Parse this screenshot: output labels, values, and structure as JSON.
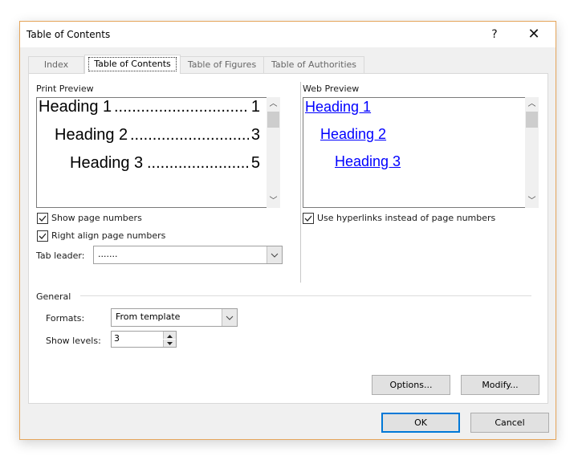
{
  "window": {
    "title": "Table of Contents",
    "help_label": "?",
    "close_label": "✕"
  },
  "tabs": [
    {
      "label": "Index",
      "active": false
    },
    {
      "label": "Table of Contents",
      "active": true
    },
    {
      "label": "Table of Figures",
      "active": false
    },
    {
      "label": "Table of Authorities",
      "active": false
    }
  ],
  "print_preview": {
    "label": "Print Preview",
    "lines": [
      {
        "text": "Heading 1",
        "page": "1"
      },
      {
        "text": "Heading 2",
        "page": "3"
      },
      {
        "text": "Heading 3",
        "page": "5"
      }
    ],
    "leader": "................................................................................"
  },
  "web_preview": {
    "label": "Web Preview",
    "links": [
      "Heading 1",
      "Heading 2",
      "Heading 3"
    ]
  },
  "options": {
    "show_page_numbers": {
      "label": "Show page numbers",
      "checked": true
    },
    "right_align": {
      "label": "Right align page numbers",
      "checked": true
    },
    "use_hyperlinks": {
      "label": "Use hyperlinks instead of page numbers",
      "checked": true
    },
    "tab_leader": {
      "label": "Tab leader:",
      "value": "......."
    }
  },
  "general": {
    "label": "General",
    "formats": {
      "label": "Formats:",
      "value": "From template"
    },
    "show_levels": {
      "label": "Show levels:",
      "value": "3"
    }
  },
  "buttons": {
    "options": "Options...",
    "modify": "Modify...",
    "ok": "OK",
    "cancel": "Cancel"
  },
  "colors": {
    "accent": "#0078d7",
    "link": "#0000ff",
    "window_border": "#e5a55a"
  }
}
